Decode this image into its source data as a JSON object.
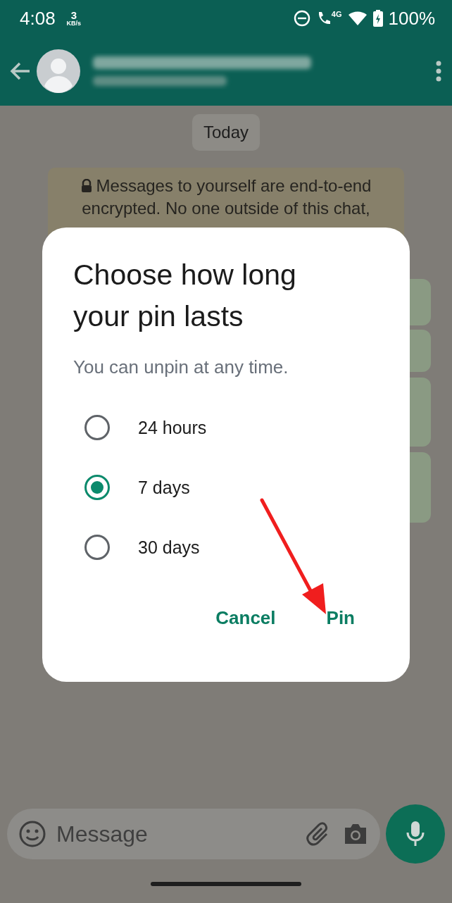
{
  "status_bar": {
    "time": "4:08",
    "speed_value": "3",
    "speed_unit": "KB/s",
    "network": "4G",
    "battery": "100%"
  },
  "chat": {
    "date_chip": "Today",
    "notice": "Messages to yourself are end-to-end encrypted. No one outside of this chat,"
  },
  "dialog": {
    "title": "Choose how long your pin lasts",
    "subtitle": "You can unpin at any time.",
    "options": [
      {
        "label": "24 hours",
        "selected": false
      },
      {
        "label": "7 days",
        "selected": true
      },
      {
        "label": "30 days",
        "selected": false
      }
    ],
    "buttons": [
      "Cancel",
      "Pin"
    ]
  },
  "composer": {
    "placeholder": "Message"
  }
}
